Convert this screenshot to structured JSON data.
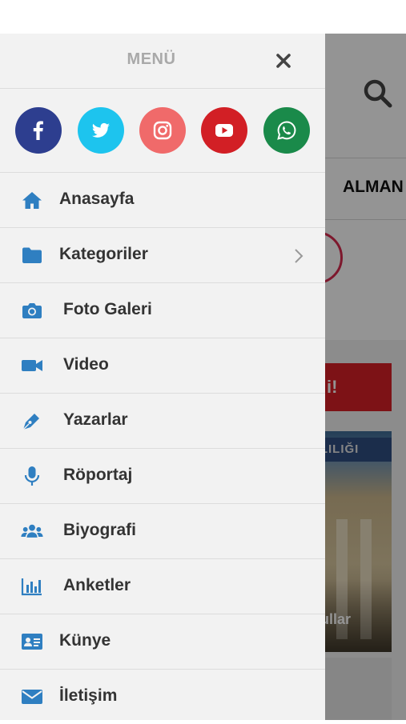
{
  "drawer": {
    "title": "MENÜ",
    "social": [
      {
        "name": "facebook-icon",
        "color": "#2d3e8f"
      },
      {
        "name": "twitter-icon",
        "color": "#1dc4ee"
      },
      {
        "name": "instagram-icon",
        "color": "#f06a6a"
      },
      {
        "name": "youtube-icon",
        "color": "#d21f25"
      },
      {
        "name": "whatsapp-icon",
        "color": "#1a8a4a"
      }
    ],
    "items": [
      {
        "label": "Anasayfa",
        "icon": "home-icon"
      },
      {
        "label": "Kategoriler",
        "icon": "folder-icon"
      },
      {
        "label": "Foto Galeri",
        "icon": "camera-icon"
      },
      {
        "label": "Video",
        "icon": "video-camera-icon"
      },
      {
        "label": "Yazarlar",
        "icon": "pen-icon"
      },
      {
        "label": "Röportaj",
        "icon": "microphone-icon"
      },
      {
        "label": "Biyografi",
        "icon": "users-icon"
      },
      {
        "label": "Anketler",
        "icon": "bar-chart-icon"
      },
      {
        "label": "Künye",
        "icon": "id-card-icon"
      },
      {
        "label": "İletişim",
        "icon": "envelope-icon"
      }
    ],
    "accent_color": "#2f7fc1"
  },
  "background": {
    "tab_label": "ALMAN",
    "banner_text": "i!",
    "news_sign": "ALILIĞI",
    "news_caption": "ullar"
  }
}
